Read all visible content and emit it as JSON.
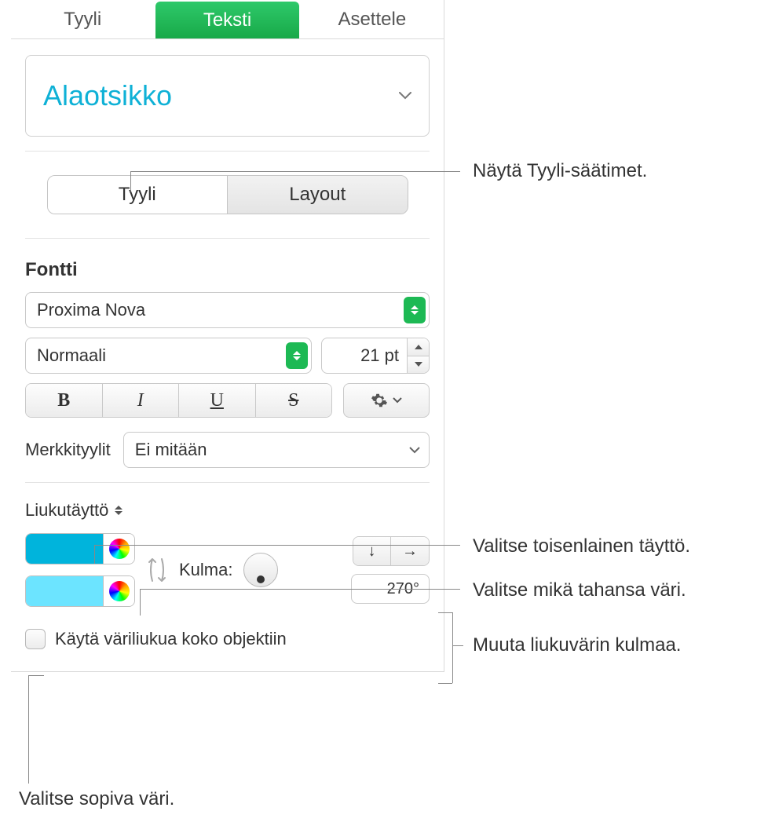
{
  "topTabs": {
    "style": "Tyyli",
    "text": "Teksti",
    "arrange": "Asettele"
  },
  "paragraphStyle": "Alaotsikko",
  "subTabs": {
    "style": "Tyyli",
    "layout": "Layout"
  },
  "font": {
    "heading": "Fontti",
    "family": "Proxima Nova",
    "weight": "Normaali",
    "size": "21 pt",
    "bold": "B",
    "italic": "I",
    "underline": "U",
    "strike": "S",
    "characterStylesLabel": "Merkkityylit",
    "characterStyle": "Ei mitään"
  },
  "fill": {
    "type": "Liukutäyttö",
    "angleLabel": "Kulma:",
    "angleValue": "270°",
    "applyToObject": "Käytä väriliukua koko objektiin"
  },
  "callouts": {
    "showStyle": "Näytä Tyyli-säätimet.",
    "chooseFill": "Valitse toisenlainen täyttö.",
    "chooseAnyColor": "Valitse mikä tahansa väri.",
    "changeAngle": "Muuta liukuvärin kulmaa.",
    "chooseColor": "Valitse sopiva väri."
  }
}
